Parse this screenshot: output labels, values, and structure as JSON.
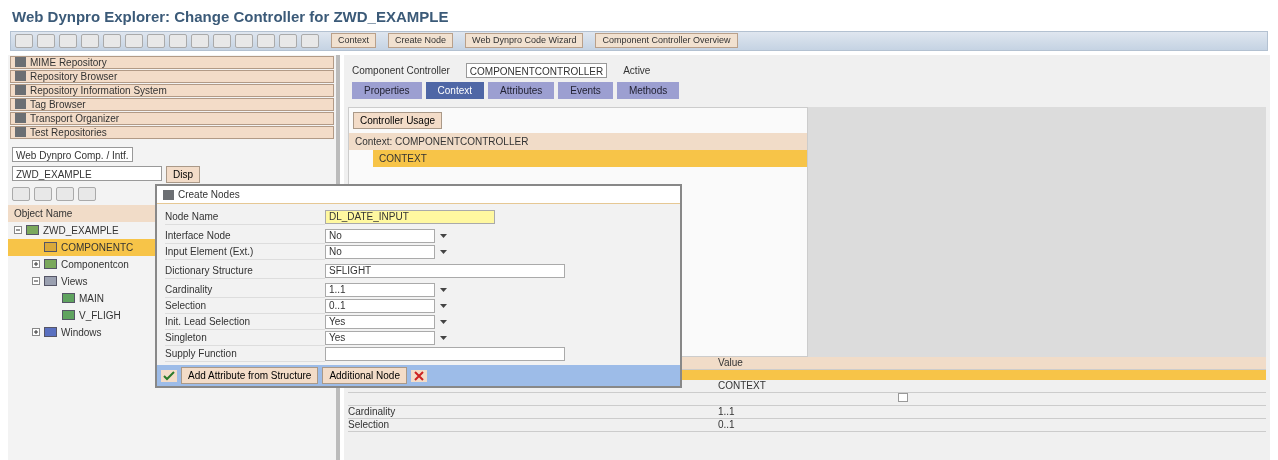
{
  "window": {
    "title": "Web Dynpro Explorer: Change Controller for ZWD_EXAMPLE"
  },
  "toolbar": {
    "fields": [
      "Context",
      "Create Node",
      "Web Dynpro Code Wizard",
      "Component Controller Overview"
    ]
  },
  "navigator": {
    "items": [
      {
        "label": "MIME Repository"
      },
      {
        "label": "Repository Browser"
      },
      {
        "label": "Repository Information System"
      },
      {
        "label": "Tag Browser"
      },
      {
        "label": "Transport Organizer"
      },
      {
        "label": "Test Repositories"
      }
    ],
    "object_type": "Web Dynpro Comp. / Intf.",
    "object_name": "ZWD_EXAMPLE",
    "display_button": "Disp",
    "column_header": "Object Name",
    "tree": [
      {
        "label": "ZWD_EXAMPLE",
        "kind": "component",
        "selected": false,
        "expanded": true,
        "children": [
          {
            "label": "COMPONENTC",
            "kind": "controller",
            "selected": true
          },
          {
            "label": "Componentcon",
            "kind": "component",
            "selected": false,
            "expanded": false
          },
          {
            "label": "Views",
            "kind": "folder",
            "selected": false,
            "expanded": true,
            "children": [
              {
                "label": "MAIN",
                "kind": "view",
                "selected": false
              },
              {
                "label": "V_FLIGH",
                "kind": "view",
                "selected": false
              }
            ]
          },
          {
            "label": "Windows",
            "kind": "window",
            "selected": false,
            "expanded": false
          }
        ]
      }
    ]
  },
  "controller": {
    "label": "Component Controller",
    "name": "COMPONENTCONTROLLER",
    "status": "Active",
    "tabs": [
      {
        "label": "Properties",
        "selected": false
      },
      {
        "label": "Context",
        "selected": true
      },
      {
        "label": "Attributes",
        "selected": false
      },
      {
        "label": "Events",
        "selected": false
      },
      {
        "label": "Methods",
        "selected": false
      }
    ],
    "usage_button": "Controller Usage",
    "context_root": "Context: COMPONENTCONTROLLER",
    "context_node": "CONTEXT",
    "table": {
      "columns": [
        "Value"
      ],
      "rows": [
        {
          "kind": "text",
          "value": "CONTEXT"
        },
        {
          "kind": "checkbox",
          "checked": false
        },
        {
          "kind": "text",
          "property": "Cardinality",
          "value": "1..1"
        },
        {
          "kind": "text",
          "property": "Selection",
          "value": "0..1"
        }
      ]
    }
  },
  "dialog": {
    "title": "Create Nodes",
    "field_groups": [
      [
        {
          "label": "Node Name",
          "value": "DL_DATE_INPUT",
          "kind": "required"
        }
      ],
      [
        {
          "label": "Interface Node",
          "value": "No",
          "kind": "dropdown"
        },
        {
          "label": "Input Element (Ext.)",
          "value": "No",
          "kind": "dropdown"
        }
      ],
      [
        {
          "label": "Dictionary Structure",
          "value": "SFLIGHT",
          "kind": "text"
        }
      ],
      [
        {
          "label": "Cardinality",
          "value": "1..1",
          "kind": "dropdown"
        },
        {
          "label": "Selection",
          "value": "0..1",
          "kind": "dropdown"
        },
        {
          "label": "Init. Lead Selection",
          "value": "Yes",
          "kind": "dropdown"
        },
        {
          "label": "Singleton",
          "value": "Yes",
          "kind": "dropdown"
        },
        {
          "label": "Supply Function",
          "kind": "text"
        }
      ]
    ],
    "buttons": [
      "Add Attribute from Structure",
      "Additional Node"
    ]
  }
}
